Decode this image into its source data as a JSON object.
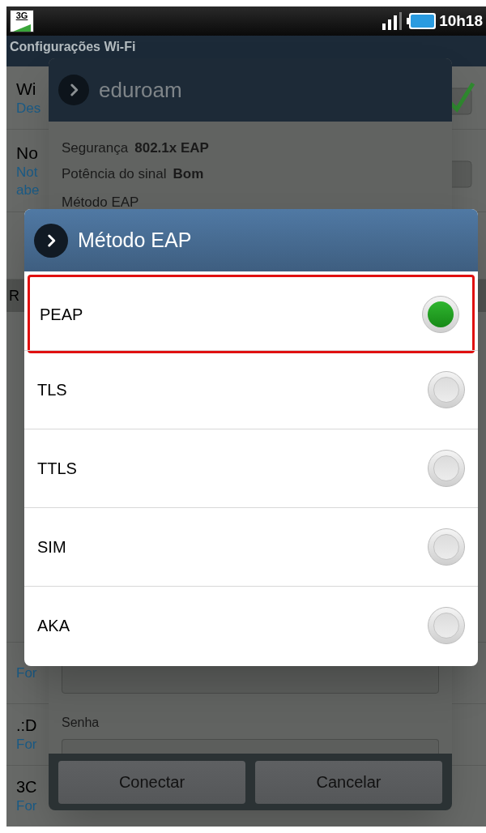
{
  "status_bar": {
    "network_badge": "3G",
    "time": "10h18"
  },
  "title": "Configurações Wi-Fi",
  "background_list": {
    "items": [
      {
        "title": "Wi",
        "subtitle_lines": [
          "Des"
        ],
        "checked": true
      },
      {
        "title": "No",
        "subtitle_lines": [
          "Not",
          "abe"
        ],
        "checked": false
      }
    ],
    "section_header": "R",
    "lower_items": [
      {
        "subtitle": "For"
      },
      {
        "title": ".:D",
        "subtitle": "For"
      },
      {
        "title": "3C",
        "subtitle": "For"
      }
    ]
  },
  "network_dialog": {
    "title": "eduroam",
    "details": [
      {
        "label": "Segurança",
        "value": "802.1x EAP"
      },
      {
        "label": "Potência do sinal",
        "value": "Bom"
      }
    ],
    "field_label": "Método EAP",
    "password_label": "Senha",
    "buttons": [
      "Conectar",
      "Cancelar"
    ]
  },
  "eap_dialog": {
    "title": "Método EAP",
    "options": [
      {
        "label": "PEAP",
        "selected": true,
        "highlighted": true
      },
      {
        "label": "TLS",
        "selected": false,
        "highlighted": false
      },
      {
        "label": "TTLS",
        "selected": false,
        "highlighted": false
      },
      {
        "label": "SIM",
        "selected": false,
        "highlighted": false
      },
      {
        "label": "AKA",
        "selected": false,
        "highlighted": false
      }
    ]
  }
}
